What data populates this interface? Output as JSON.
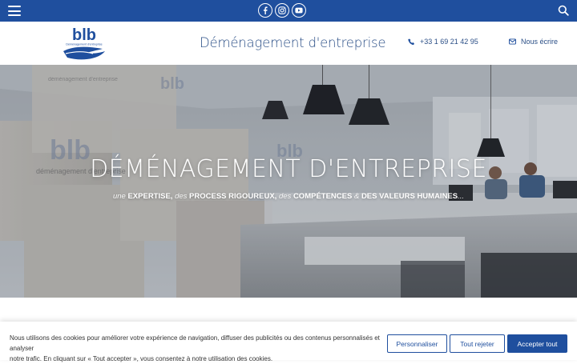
{
  "header": {
    "tagline": "Déménagement d'entreprise",
    "phone": "+33 1 69 21 42 95",
    "mail_label": "Nous écrire",
    "logo_text": "blb",
    "logo_small": "Déménagement d'entreprise"
  },
  "hero": {
    "title": "DÉMÉNAGEMENT D'ENTREPRISE",
    "sub": {
      "p1": "une",
      "b1": "EXPERTISE,",
      "p2": "des",
      "b2": "PROCESS RIGOUREUX,",
      "p3": "des",
      "b3": "COMPÉTENCES",
      "p4": "&",
      "b4": "DES VALEURS HUMAINES",
      "end": "..."
    },
    "photo": {
      "box_brand": "blb",
      "box_caption": "déménagement d'entreprise"
    }
  },
  "cookie": {
    "line1": "Nous utilisons des cookies pour améliorer votre expérience de navigation, diffuser des publicités ou des contenus personnalisés et analyser",
    "line2": "notre trafic. En cliquant sur « Tout accepter », vous consentez à notre utilisation des cookies.",
    "customize": "Personnaliser",
    "reject": "Tout rejeter",
    "accept": "Accepter tout"
  },
  "colors": {
    "brand": "#1f4f9e",
    "text_blue": "#2b4f87"
  },
  "icons": [
    "menu-icon",
    "facebook-icon",
    "instagram-icon",
    "youtube-icon",
    "search-icon",
    "phone-icon",
    "mail-icon"
  ]
}
